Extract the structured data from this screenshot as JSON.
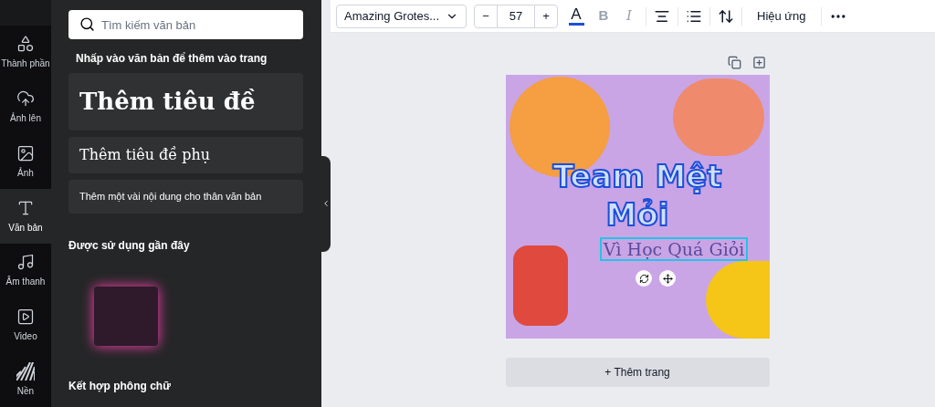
{
  "rail": [
    {
      "label": "Thành phần",
      "selected": false
    },
    {
      "label": "Ảnh lên",
      "selected": false
    },
    {
      "label": "Ảnh",
      "selected": false
    },
    {
      "label": "Văn bản",
      "selected": true
    },
    {
      "label": "Âm thanh",
      "selected": false
    },
    {
      "label": "Video",
      "selected": false
    },
    {
      "label": "Nền",
      "selected": false
    }
  ],
  "panel": {
    "search": {
      "placeholder": "Tìm kiếm văn bản"
    },
    "add_heading": "Nhấp vào văn bản để thêm vào trang",
    "text_presets": [
      {
        "kind": "title",
        "label": "Thêm tiêu đề"
      },
      {
        "kind": "subtitle",
        "label": "Thêm tiêu đề phụ"
      },
      {
        "kind": "body",
        "label": "Thêm một vài nội dung cho thân văn bản"
      }
    ],
    "recent_heading": "Được sử dụng gần đây",
    "pairings_heading": "Kết hợp phông chữ"
  },
  "toolbar": {
    "font": "Amazing Grotes...",
    "decrease": "−",
    "size": "57",
    "increase": "+",
    "text_color_label": "A",
    "bold_label": "B",
    "italic_label": "I",
    "effects": "Hiệu ứng"
  },
  "design": {
    "title_lines": [
      "Team Mệt",
      "Mỏi"
    ],
    "subtitle": "Vì Học Quá Giỏi",
    "add_page": "+ Thêm trang"
  }
}
